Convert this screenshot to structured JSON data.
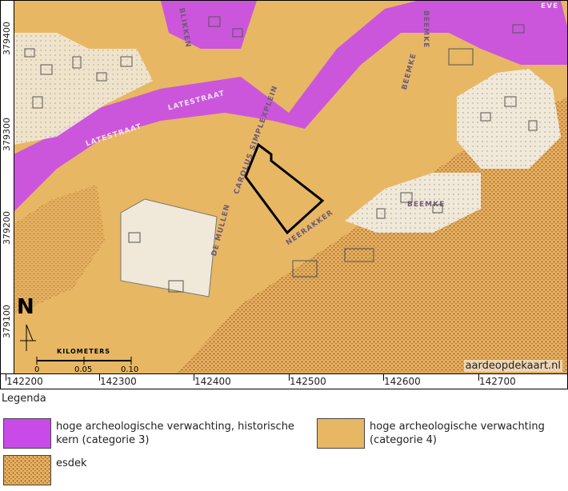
{
  "map": {
    "y_ticks": [
      "379400",
      "379300",
      "379200",
      "379100"
    ],
    "x_ticks": [
      "142200",
      "142300",
      "142400",
      "142500",
      "142600",
      "142700"
    ],
    "north_label": "N",
    "scale": {
      "title": "KILOMETERS",
      "labels": [
        "0",
        "0.05",
        "0.10"
      ]
    },
    "credit": "aardeopdekaart.nl",
    "streets": {
      "blikken": "BLIKKEN",
      "beemke_1": "BEEMKE",
      "beemke_2": "BEEMKE",
      "beemke_3": "BEEMKE",
      "latestraat_1": "LATESTRAAT",
      "latestraat_2": "LATESTRAAT",
      "carolus": "CAROLUS SIMPLEXPLEIN",
      "de_mullen": "DE MULLEN",
      "neerakker": "NEERAKKER",
      "leve": "EVE"
    },
    "colors": {
      "historic_core": "#c84be8",
      "category4": "#e7b764",
      "esdek": "#e6ad5e",
      "built": "#f0e8d8"
    }
  },
  "legend": {
    "title": "Legenda",
    "items": [
      {
        "label": "hoge archeologische verwachting, historische kern (categorie 3)",
        "color": "#c84be8"
      },
      {
        "label": "hoge archeologische verwachting (categorie 4)",
        "color": "#e7b764"
      },
      {
        "label": "esdek",
        "color": "#e6ad5e"
      }
    ]
  }
}
